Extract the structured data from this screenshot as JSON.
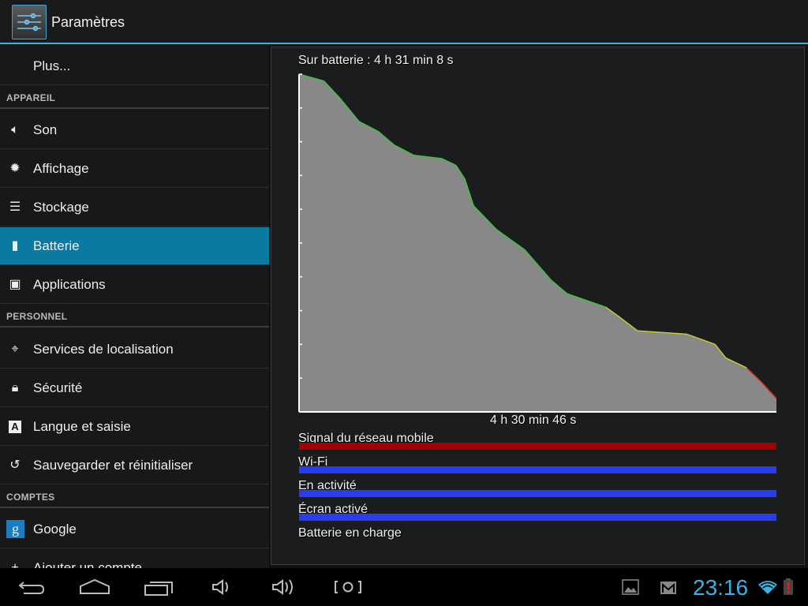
{
  "header": {
    "title": "Paramètres"
  },
  "sidebar": {
    "plus": "Plus...",
    "sections": [
      {
        "header": "APPAREIL",
        "items": [
          {
            "label": "Son",
            "icon": "speaker-icon"
          },
          {
            "label": "Affichage",
            "icon": "brightness-icon"
          },
          {
            "label": "Stockage",
            "icon": "storage-icon"
          },
          {
            "label": "Batterie",
            "icon": "battery-icon",
            "selected": true
          },
          {
            "label": "Applications",
            "icon": "apps-icon"
          }
        ]
      },
      {
        "header": "PERSONNEL",
        "items": [
          {
            "label": "Services de localisation",
            "icon": "location-icon"
          },
          {
            "label": "Sécurité",
            "icon": "lock-icon"
          },
          {
            "label": "Langue et saisie",
            "icon": "keyboard-icon"
          },
          {
            "label": "Sauvegarder et réinitialiser",
            "icon": "restore-icon"
          }
        ]
      },
      {
        "header": "COMPTES",
        "items": [
          {
            "label": "Google",
            "icon": "google-icon"
          },
          {
            "label": "Ajouter un compte",
            "icon": "add-icon"
          }
        ]
      }
    ]
  },
  "battery": {
    "on_battery": "Sur batterie : 4 h 31 min 8 s",
    "duration_label": "4 h 30 min 46 s",
    "signals": [
      {
        "label": "Signal du réseau mobile",
        "color": "#a00000"
      },
      {
        "label": "Wi-Fi",
        "color": "#2a3cf2"
      },
      {
        "label": "En activité",
        "color": "#2a3cf2"
      },
      {
        "label": "Écran activé",
        "color": "#2a3cf2"
      },
      {
        "label": "Batterie en charge",
        "color": null
      }
    ]
  },
  "chart_data": {
    "type": "area",
    "x_unit": "minutes on battery",
    "ylim": [
      0,
      100
    ],
    "xlim": [
      0,
      270.8
    ],
    "fill_color": "#888888",
    "line_colors": {
      "high": "#3cc43c",
      "medium": "#c8c832",
      "low": "#dd2222"
    },
    "points": [
      [
        0,
        100
      ],
      [
        14,
        98
      ],
      [
        23,
        93
      ],
      [
        34,
        86
      ],
      [
        45,
        83
      ],
      [
        54,
        79
      ],
      [
        65,
        76
      ],
      [
        81,
        75
      ],
      [
        89,
        73
      ],
      [
        94,
        69
      ],
      [
        99,
        61
      ],
      [
        112,
        54
      ],
      [
        128,
        48
      ],
      [
        143,
        39
      ],
      [
        152,
        35
      ],
      [
        174,
        31
      ],
      [
        182,
        28
      ],
      [
        192,
        24
      ],
      [
        220,
        23
      ],
      [
        236,
        20
      ],
      [
        242,
        16
      ],
      [
        254,
        13
      ],
      [
        262,
        9
      ],
      [
        270.8,
        4
      ]
    ]
  },
  "statusbar": {
    "time": "23:16"
  },
  "navbar": {
    "buttons": [
      "back",
      "home",
      "recent-apps",
      "volume-down",
      "volume-up",
      "screenshot"
    ]
  }
}
